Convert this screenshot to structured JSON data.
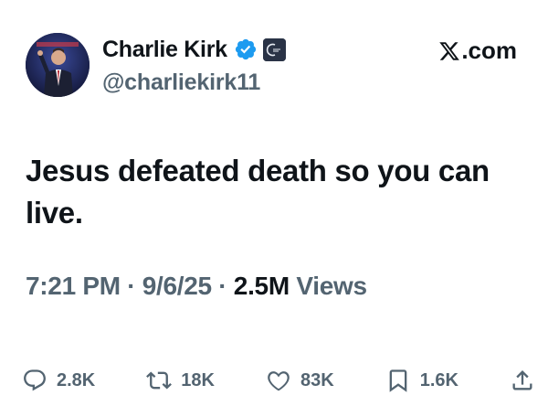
{
  "tweet": {
    "author_name": "Charlie Kirk",
    "handle": "@charliekirk11",
    "brand": ".com",
    "text": "Jesus defeated death so you can live.",
    "time": "7:21 PM",
    "date": "9/6/25",
    "views_count": "2.5M",
    "views_label": "Views",
    "separator": "·",
    "colors": {
      "text": "#0f1419",
      "muted": "#536471",
      "verified": "#1d9bf0"
    }
  },
  "actions": {
    "replies": "2.8K",
    "reposts": "18K",
    "likes": "83K",
    "bookmarks": "1.6K"
  }
}
